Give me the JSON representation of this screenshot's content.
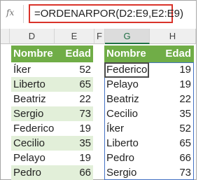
{
  "formula_bar": {
    "fx_label": "fx",
    "formula": "=ORDENARPOR(D2:E9,E2:E9)"
  },
  "columns": [
    "D",
    "E",
    "F",
    "G",
    "H"
  ],
  "source_table": {
    "headers": [
      "Nombre",
      "Edad"
    ],
    "rows": [
      {
        "name": "Íker",
        "age": "52"
      },
      {
        "name": "Liberto",
        "age": "65"
      },
      {
        "name": "Beatriz",
        "age": "22"
      },
      {
        "name": "Sergio",
        "age": "73"
      },
      {
        "name": "Federico",
        "age": "19"
      },
      {
        "name": "Cecilio",
        "age": "35"
      },
      {
        "name": "Pelayo",
        "age": "19"
      },
      {
        "name": "Pedro",
        "age": "66"
      }
    ]
  },
  "result_table": {
    "headers": [
      "Nombre",
      "Edad"
    ],
    "rows": [
      {
        "name": "Federico",
        "age": "19"
      },
      {
        "name": "Pelayo",
        "age": "19"
      },
      {
        "name": "Beatriz",
        "age": "22"
      },
      {
        "name": "Cecilio",
        "age": "35"
      },
      {
        "name": "Íker",
        "age": "52"
      },
      {
        "name": "Liberto",
        "age": "65"
      },
      {
        "name": "Pedro",
        "age": "66"
      },
      {
        "name": "Sergio",
        "age": "73"
      }
    ]
  },
  "colors": {
    "header_green": "#70ad47",
    "band_green": "#e2efd9",
    "formula_highlight": "#d9332a",
    "spill_outline": "#4472c4"
  }
}
